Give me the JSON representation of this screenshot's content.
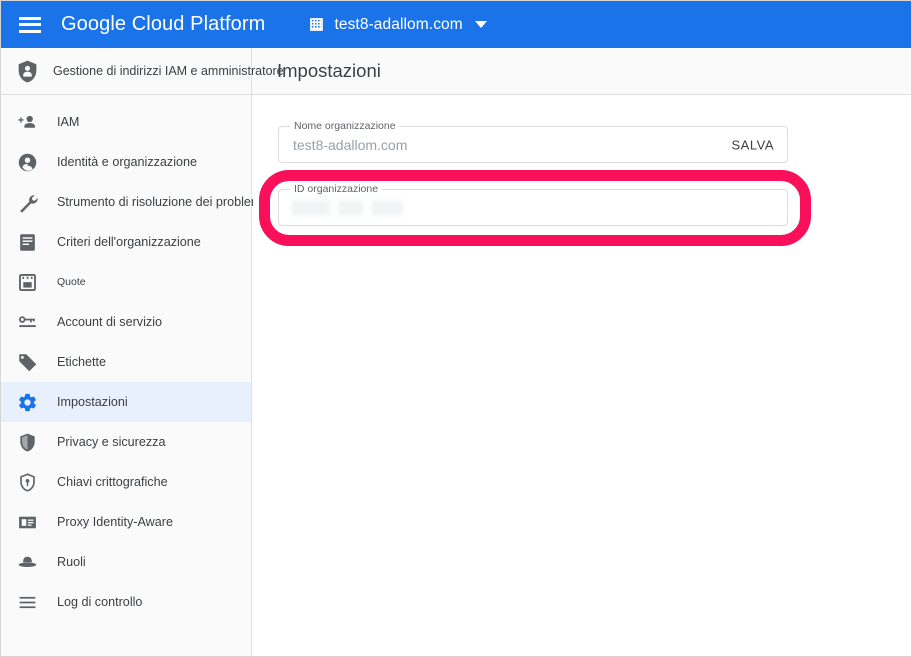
{
  "appbar": {
    "menu_icon": "hamburger-menu-icon",
    "brand": "Google Cloud Platform",
    "org_icon": "building-icon",
    "org_name": "test8-adallom.com",
    "caret_icon": "chevron-down-icon",
    "background_color": "#1a73e8"
  },
  "product_header": {
    "icon": "shield-person-icon",
    "title": "Gestione di indirizzi IAM e amministratore",
    "page_title": "Impostazioni"
  },
  "sidebar": {
    "background_color": "#fafafa",
    "active_background_color": "#e8f0fe",
    "active_icon_color": "#1a73e8",
    "items": [
      {
        "label": "IAM",
        "icon": "person-add-icon",
        "active": false
      },
      {
        "label": "Identità e organizzazione",
        "icon": "account-circle-icon",
        "active": false
      },
      {
        "label": "Strumento di risoluzione dei problemi",
        "icon": "wrench-icon",
        "active": false
      },
      {
        "label": "Criteri dell'organizzazione",
        "icon": "document-lines-icon",
        "active": false
      },
      {
        "label": "Quote",
        "icon": "quota-calendar-icon",
        "active": false
      },
      {
        "label": "Account di servizio",
        "icon": "key-card-icon",
        "active": false
      },
      {
        "label": "Etichette",
        "icon": "tag-icon",
        "active": false
      },
      {
        "label": "Impostazioni",
        "icon": "gear-icon",
        "active": true
      },
      {
        "label": "Privacy e sicurezza",
        "icon": "shield-icon",
        "active": false
      },
      {
        "label": "Chiavi crittografiche",
        "icon": "shield-key-icon",
        "active": false
      },
      {
        "label": "Proxy Identity-Aware",
        "icon": "iap-panel-icon",
        "active": false
      },
      {
        "label": "Ruoli",
        "icon": "hat-icon",
        "active": false
      },
      {
        "label": "Log di controllo",
        "icon": "list-lines-icon",
        "active": false
      }
    ]
  },
  "main": {
    "org_name_field": {
      "label": "Nome organizzazione",
      "value": "test8-adallom.com",
      "save_label": "SALVA"
    },
    "org_id_field": {
      "label": "ID organizzazione",
      "value": ""
    }
  },
  "annotation": {
    "color": "#fa0f5a",
    "target": "org-id-field"
  }
}
